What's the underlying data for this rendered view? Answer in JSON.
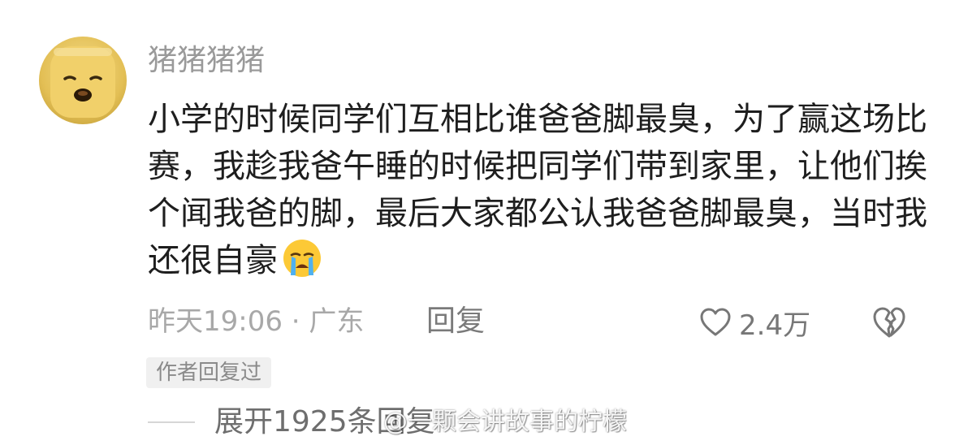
{
  "comment": {
    "username": "猪猪猪猪",
    "text": "小学的时候同学们互相比谁爸爸脚最臭，为了赢这场比赛，我趁我爸午睡的时候把同学们带到家里，让他们挨个闻我爸的脚，最后大家都公认我爸爸脚最臭，当时我还很自豪",
    "emoji": "crying-face-emoji",
    "time_location": "昨天19:06 · 广东",
    "reply_label": "回复",
    "like_count": "2.4万",
    "author_replied_badge": "作者回复过",
    "expand_replies_label": "展开1925条回复",
    "watermark": "@一颗会讲故事的柠檬"
  },
  "icons": {
    "like": "heart-outline-icon",
    "dislike": "broken-heart-icon",
    "expand": "chevron-down-icon"
  },
  "colors": {
    "text_primary": "#1e1e1e",
    "text_secondary": "#9a9a9a",
    "badge_bg": "#f0f0f0",
    "avatar_yellow": "#e3bf55"
  }
}
